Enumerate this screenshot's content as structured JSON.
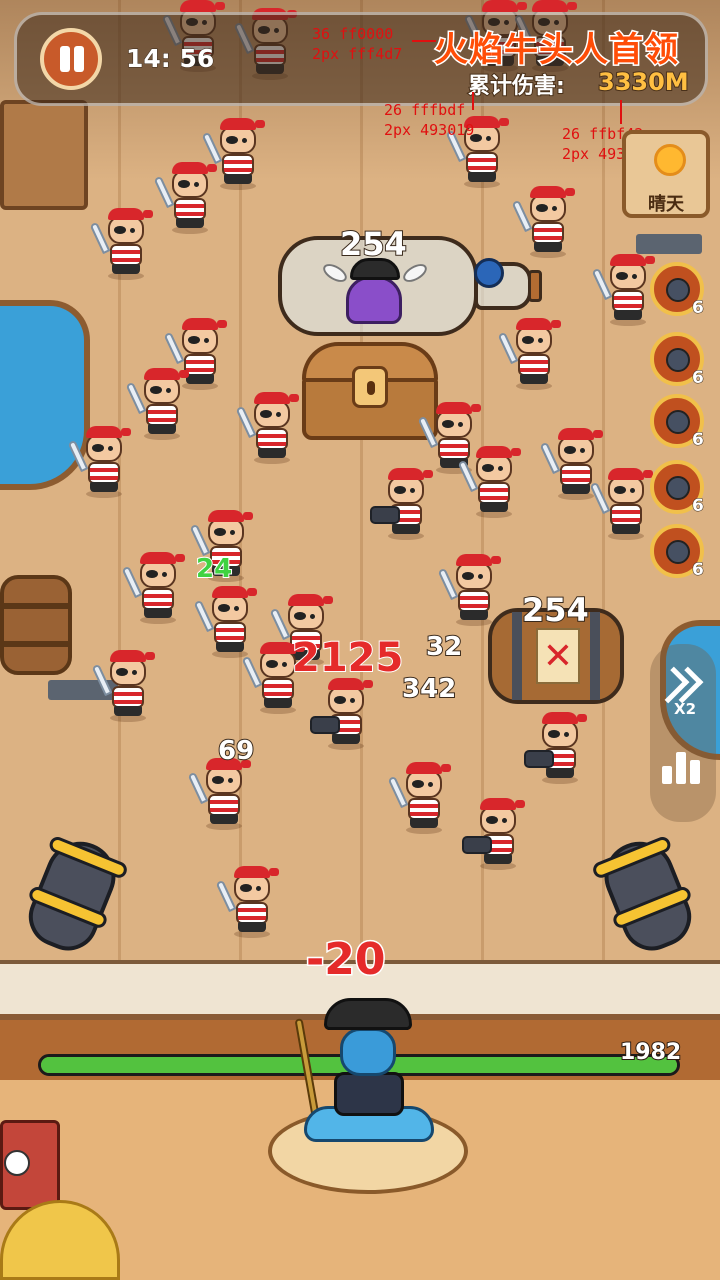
{
  "hud": {
    "timer": "14: 56",
    "boss_name": "火焰牛头人首领",
    "damage_label": "累计伤害:",
    "damage_value": "3330M"
  },
  "annotations": {
    "boss_name_size": "36 ff0000",
    "boss_name_stroke": "2px fff4d7",
    "label_size": "26 fffbdf",
    "label_stroke": "2px 493019",
    "value_size": "26 ffbf42",
    "value_stroke": "2px 493019"
  },
  "weather": {
    "label": "晴天",
    "icon": "sun-icon"
  },
  "skills": [
    {
      "icon": "bomb-icon",
      "count": "6"
    },
    {
      "icon": "bomb-icon",
      "count": "6"
    },
    {
      "icon": "bomb-icon",
      "count": "6"
    },
    {
      "icon": "bomb-icon",
      "count": "6"
    },
    {
      "icon": "bomb-icon",
      "count": "6"
    }
  ],
  "speed_button": {
    "label": "X2"
  },
  "targets": {
    "bottle_hp": "254",
    "barrel_hp": "254"
  },
  "floating_numbers": [
    {
      "text": "24",
      "style": "green"
    },
    {
      "text": "2125",
      "style": "red-big"
    },
    {
      "text": "32",
      "style": "white"
    },
    {
      "text": "342",
      "style": "white"
    },
    {
      "text": "69",
      "style": "white"
    }
  ],
  "hero": {
    "damage_taken": "-20",
    "hp": "1982",
    "hp_fraction": 1.0
  },
  "colors": {
    "boss_name": "#ff4d07",
    "damage_value": "#ffbf42",
    "hp_fill": "#53c23f",
    "enemy_bandana": "#d8262b"
  }
}
